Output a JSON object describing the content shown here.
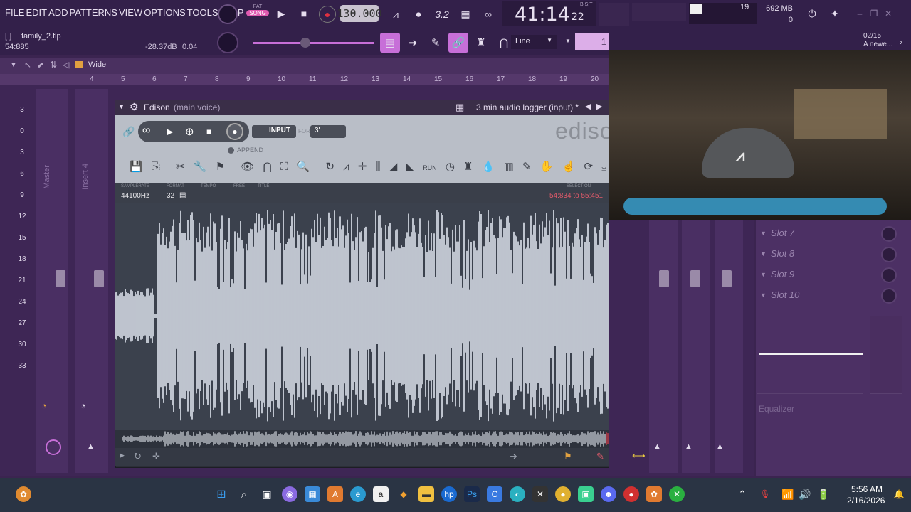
{
  "menu": [
    "FILE",
    "EDIT",
    "ADD",
    "PATTERNS",
    "VIEW",
    "OPTIONS",
    "TOOLS",
    "HELP"
  ],
  "transport": {
    "mode_top": "PAT",
    "mode_bottom": "SONG",
    "tempo": "130.000",
    "time": "41:14",
    "time_small": "22",
    "time_zone": "B:S:T",
    "pattern_number": "3.2"
  },
  "status": {
    "cpu": "19",
    "memory": "692 MB",
    "voices": "0"
  },
  "project": {
    "bracket": "[ ]",
    "filename": "family_2.flp",
    "position": "54:885",
    "volume_db": "-28.37dB",
    "pitch": "0.04"
  },
  "toolbar": {
    "snap_mode": "Line",
    "pattern_field": "1"
  },
  "news": {
    "date": "02/15",
    "headline": "A newe..."
  },
  "playlist": {
    "view_mode": "Wide",
    "ruler": [
      "4",
      "5",
      "6",
      "7",
      "8",
      "9",
      "10",
      "11",
      "12",
      "13",
      "14",
      "15",
      "16",
      "17",
      "18",
      "19",
      "20"
    ]
  },
  "mixer": {
    "strips": [
      {
        "name": "Master"
      },
      {
        "name": "Insert 4"
      }
    ],
    "db_scale": [
      "3",
      "0",
      "3",
      "6",
      "9",
      "12",
      "15",
      "18",
      "21",
      "24",
      "27",
      "30",
      "33"
    ]
  },
  "edison": {
    "title": "Edison",
    "subtitle": "(main voice)",
    "preset": "3 min audio logger (input) *",
    "input_label": "INPUT",
    "for_label": "FOR",
    "for_value": "3'",
    "append_label": "APPEND",
    "logo": "ediso",
    "samplerate_label": "SAMPLERATE",
    "samplerate": "44100Hz",
    "format_label": "FORMAT",
    "format": "32",
    "tempo_label": "TEMPO",
    "free_label": "FREE",
    "title_label": "TITLE",
    "selection_label": "SELECTION",
    "selection": "54:834 to 55:451"
  },
  "slots": [
    "Slot 7",
    "Slot 8",
    "Slot 9",
    "Slot 10"
  ],
  "equalizer_label": "Equalizer",
  "taskbar": {
    "time": "5:56 AM",
    "date": "2/16/2026"
  },
  "colors": {
    "accent": "#c76fd8",
    "background": "#3b2450",
    "waveform": "#dfe4ee",
    "selection": "#c83a4a"
  }
}
